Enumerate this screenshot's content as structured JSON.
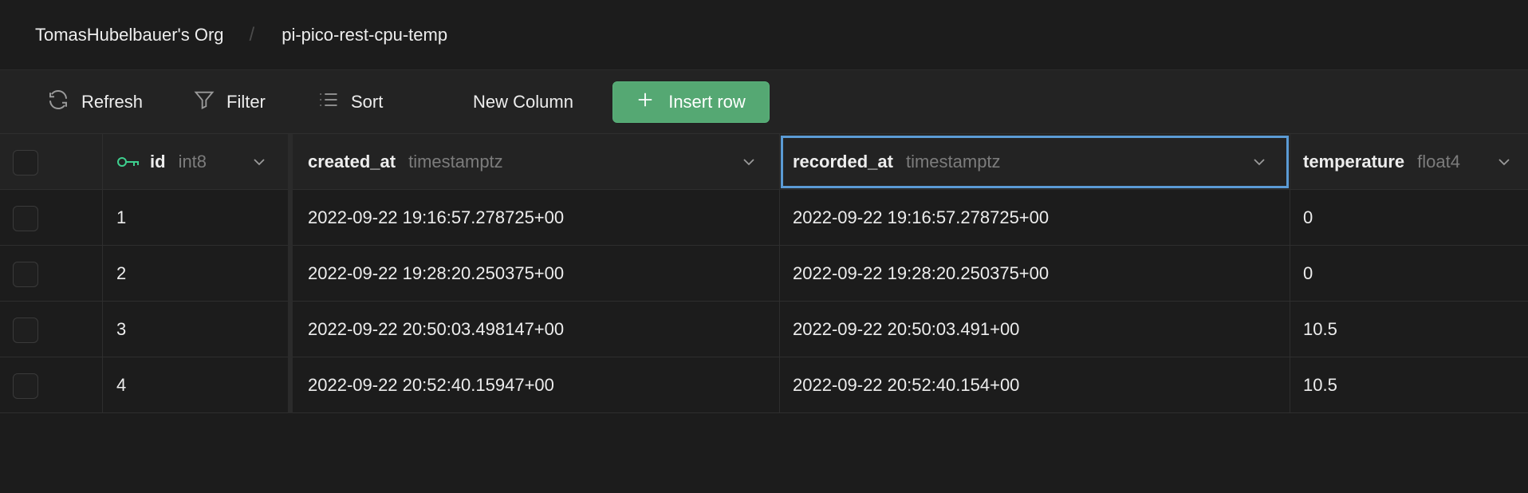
{
  "breadcrumb": {
    "org": "TomasHubelbauer's Org",
    "separator": "/",
    "project": "pi-pico-rest-cpu-temp"
  },
  "toolbar": {
    "refresh": "Refresh",
    "filter": "Filter",
    "sort": "Sort",
    "new_column": "New Column",
    "insert_row": "Insert row"
  },
  "columns": [
    {
      "name": "id",
      "type": "int8",
      "primary_key": true
    },
    {
      "name": "created_at",
      "type": "timestamptz"
    },
    {
      "name": "recorded_at",
      "type": "timestamptz",
      "selected": true
    },
    {
      "name": "temperature",
      "type": "float4"
    }
  ],
  "rows": [
    {
      "id": "1",
      "created_at": "2022-09-22 19:16:57.278725+00",
      "recorded_at": "2022-09-22 19:16:57.278725+00",
      "temperature": "0"
    },
    {
      "id": "2",
      "created_at": "2022-09-22 19:28:20.250375+00",
      "recorded_at": "2022-09-22 19:28:20.250375+00",
      "temperature": "0"
    },
    {
      "id": "3",
      "created_at": "2022-09-22 20:50:03.498147+00",
      "recorded_at": "2022-09-22 20:50:03.491+00",
      "temperature": "10.5"
    },
    {
      "id": "4",
      "created_at": "2022-09-22 20:52:40.15947+00",
      "recorded_at": "2022-09-22 20:52:40.154+00",
      "temperature": "10.5"
    }
  ],
  "icons": {
    "refresh": "refresh-icon",
    "filter": "filter-icon",
    "sort": "sort-icon",
    "insert": "plus-icon",
    "key": "key-icon",
    "chevron": "chevron-down-icon"
  },
  "colors": {
    "accent_green": "#55a873",
    "selection_blue": "#5b9bd5",
    "key_green": "#3ecf8e"
  }
}
